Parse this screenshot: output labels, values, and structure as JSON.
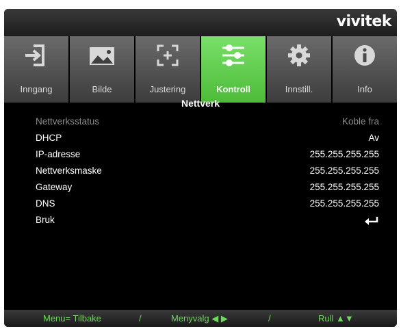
{
  "brand": {
    "logo": "vivitek"
  },
  "tabs": [
    {
      "label": "Inngang",
      "icon": "input-icon",
      "active": false
    },
    {
      "label": "Bilde",
      "icon": "image-icon",
      "active": false
    },
    {
      "label": "Justering",
      "icon": "adjust-icon",
      "active": false
    },
    {
      "label": "Kontroll",
      "icon": "sliders-icon",
      "active": true
    },
    {
      "label": "Innstill.",
      "icon": "gear-icon",
      "active": false
    },
    {
      "label": "Info",
      "icon": "info-icon",
      "active": false
    }
  ],
  "menu": {
    "title": "Nettverk",
    "rows": [
      {
        "label": "Nettverksstatus",
        "value": "Koble fra",
        "disabled": true
      },
      {
        "label": "DHCP",
        "value": "Av"
      },
      {
        "label": "IP-adresse",
        "value": "255.255.255.255"
      },
      {
        "label": "Nettverksmaske",
        "value": "255.255.255.255"
      },
      {
        "label": "Gateway",
        "value": "255.255.255.255"
      },
      {
        "label": "DNS",
        "value": "255.255.255.255"
      },
      {
        "label": "Bruk",
        "value_icon": "enter-icon"
      }
    ]
  },
  "footer": {
    "back": "Menu= Tilbake",
    "sep1": "/",
    "select": "Menyvalg ◀ ▶",
    "sep2": "/",
    "scroll": "Rull ▲▼"
  },
  "colors": {
    "accent": "#5ccb45",
    "footer_text": "#6fd85c",
    "disabled_text": "#8a8a8a"
  }
}
